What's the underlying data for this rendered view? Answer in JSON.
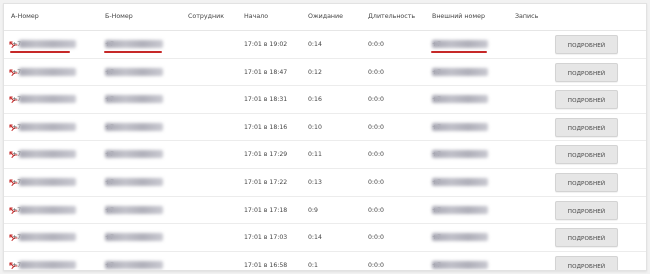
{
  "table": {
    "headers": [
      "А-Номер",
      "Б-Номер",
      "Сотрудник",
      "Начало",
      "Ожидание",
      "Длительность",
      "Внешний номер",
      "Запись"
    ],
    "details_label": "ПОДРОБНЕЙ",
    "accent_color": "#c62828",
    "rows": [
      {
        "a_prefix": "+7",
        "b_prefix": "+7",
        "employee": "",
        "start": "17:01 в 19:02",
        "wait": "0:14",
        "duration": "0:0:0",
        "ext_prefix": "+7"
      },
      {
        "a_prefix": "+7",
        "b_prefix": "+7",
        "employee": "",
        "start": "17:01 в 18:47",
        "wait": "0:12",
        "duration": "0:0:0",
        "ext_prefix": "+7"
      },
      {
        "a_prefix": "+7",
        "b_prefix": "+7",
        "employee": "",
        "start": "17:01 в 18:31",
        "wait": "0:16",
        "duration": "0:0:0",
        "ext_prefix": "+7"
      },
      {
        "a_prefix": "+7",
        "b_prefix": "+7",
        "employee": "",
        "start": "17:01 в 18:16",
        "wait": "0:10",
        "duration": "0:0:0",
        "ext_prefix": "+7"
      },
      {
        "a_prefix": "+7",
        "b_prefix": "+7",
        "employee": "",
        "start": "17:01 в 17:29",
        "wait": "0:11",
        "duration": "0:0:0",
        "ext_prefix": "+7"
      },
      {
        "a_prefix": "+7",
        "b_prefix": "+7",
        "employee": "",
        "start": "17:01 в 17:22",
        "wait": "0:13",
        "duration": "0:0:0",
        "ext_prefix": "+7"
      },
      {
        "a_prefix": "+7",
        "b_prefix": "+7",
        "employee": "",
        "start": "17:01 в 17:18",
        "wait": "0:9",
        "duration": "0:0:0",
        "ext_prefix": "+7"
      },
      {
        "a_prefix": "+7",
        "b_prefix": "+7",
        "employee": "",
        "start": "17:01 в 17:03",
        "wait": "0:14",
        "duration": "0:0:0",
        "ext_prefix": "+7"
      },
      {
        "a_prefix": "+7",
        "b_prefix": "+7",
        "employee": "",
        "start": "17:01 в 16:58",
        "wait": "0:1",
        "duration": "0:0:0",
        "ext_prefix": "+7"
      }
    ]
  }
}
